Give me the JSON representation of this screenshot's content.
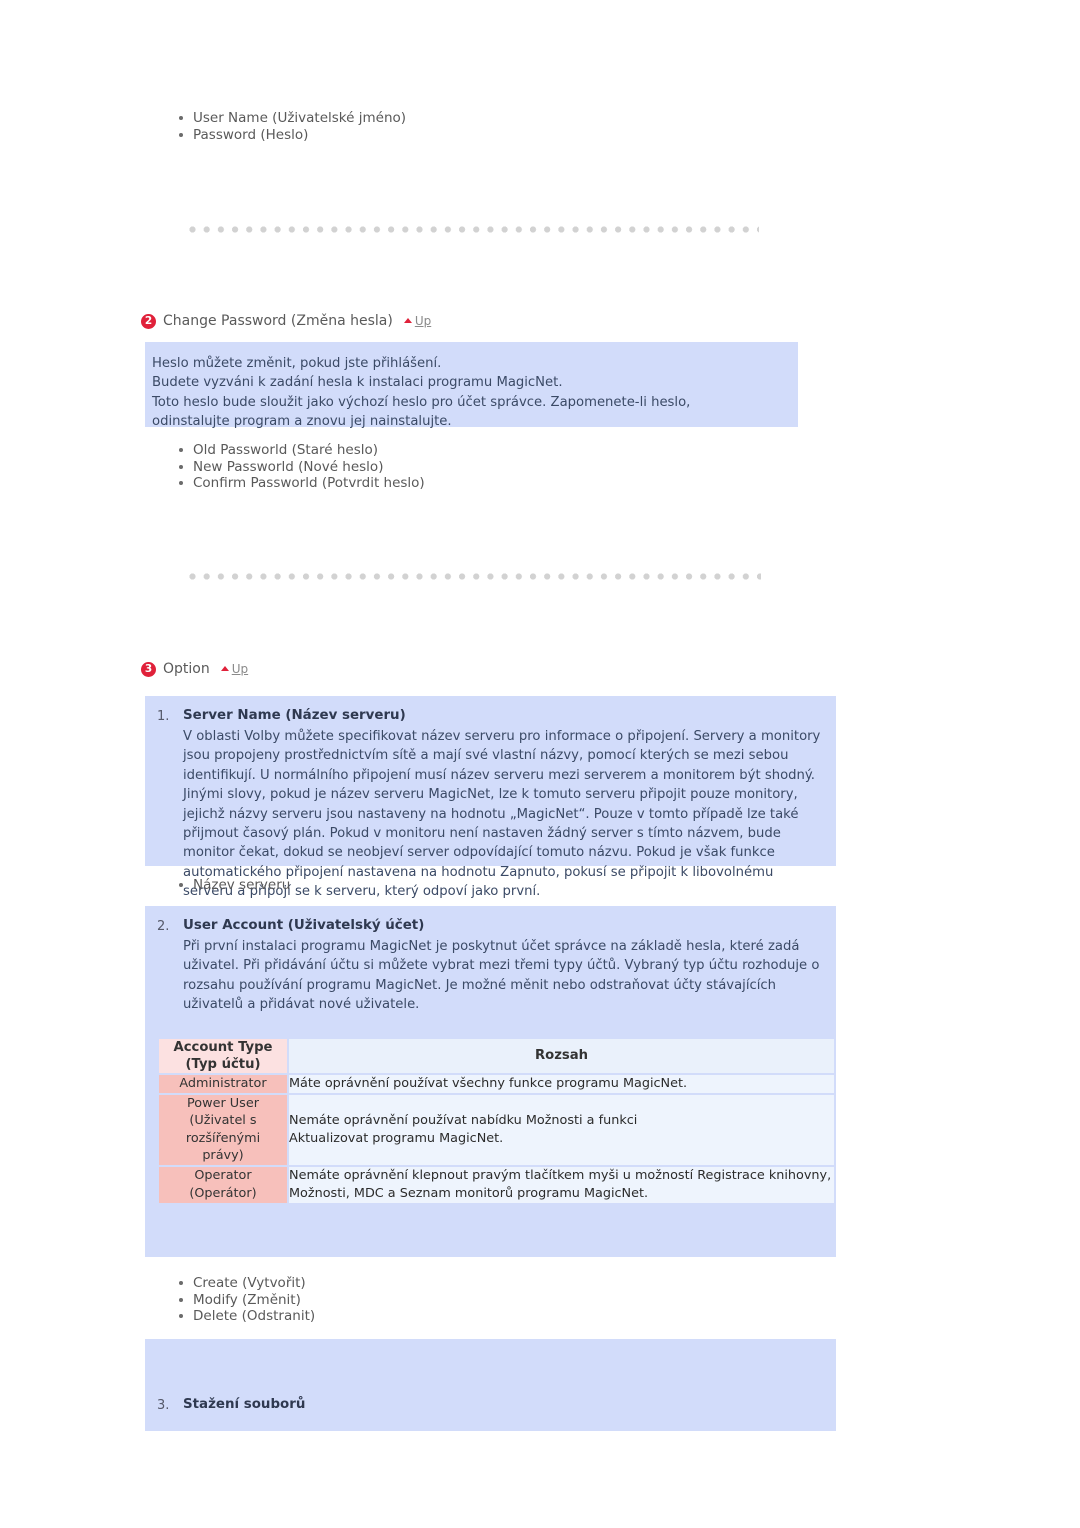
{
  "login_fields": {
    "items": [
      "User Name (Uživatelské jméno)",
      "Password (Heslo)"
    ]
  },
  "section_change_password": {
    "number": "2",
    "title": "Change Password (Změna hesla)",
    "up_label": "Up",
    "info_lines": [
      "Heslo můžete změnit, pokud jste přihlášení.",
      "Budete vyzváni k zadání hesla k instalaci programu MagicNet.",
      "Toto heslo bude sloužit jako výchozí heslo pro účet správce. Zapomenete-li heslo, odinstalujte program a znovu jej nainstalujte."
    ],
    "items": [
      "Old Passworld (Staré heslo)",
      "New Passworld (Nové heslo)",
      "Confirm Passworld (Potvrdit heslo)"
    ]
  },
  "section_option": {
    "number": "3",
    "title": "Option",
    "up_label": "Up",
    "server_name": {
      "index": "1.",
      "heading": "Server Name (Název serveru)",
      "paragraph": "V oblasti Volby můžete specifikovat název serveru pro informace o připojení. Servery a monitory jsou propojeny prostřednictvím sítě a mají své vlastní názvy, pomocí kterých se mezi sebou identifikují. U normálního připojení musí název serveru mezi serverem a monitorem být shodný. Jinými slovy, pokud je název serveru MagicNet, lze k tomuto serveru připojit pouze monitory, jejichž názvy serveru jsou nastaveny na hodnotu „MagicNet“. Pouze v tomto případě lze také přijmout časový plán. Pokud v monitoru není nastaven žádný server s tímto názvem, bude monitor čekat, dokud se neobjeví server odpovídající tomuto názvu. Pokud je však funkce automatického připojení nastavena na hodnotu Zapnuto, pokusí se připojit k libovolnému serveru a připojí se k serveru, který odpoví jako první."
    },
    "server_name_bullets": [
      "Název serveru"
    ],
    "user_account": {
      "index": "2.",
      "heading": "User Account (Uživatelský účet)",
      "paragraph": "Při první instalaci programu MagicNet je poskytnut účet správce na základě hesla, které zadá uživatel. Při přidávání účtu si můžete vybrat mezi třemi typy účtů. Vybraný typ účtu rozhoduje o rozsahu používání programu MagicNet. Je možné měnit nebo odstraňovat účty stávajících uživatelů a přidávat nové uživatele."
    },
    "account_table": {
      "headers": [
        "Account Type\n(Typ účtu)",
        "Rozsah"
      ],
      "header_type_line1": "Account Type",
      "header_type_line2": "(Typ účtu)",
      "header_scope": "Rozsah",
      "rows": [
        {
          "type": "Administrator",
          "type_lines": [
            "Administrator"
          ],
          "scope": "Máte oprávnění používat všechny funkce programu MagicNet."
        },
        {
          "type": "Power User (Uživatel s rozšířenými právy)",
          "type_lines": [
            "Power User",
            "(Uživatel s",
            "rozšířenými",
            "právy)"
          ],
          "scope": "Nemáte oprávnění používat nabídku Možnosti a funkci Aktualizovat programu MagicNet."
        },
        {
          "type": "Operator (Operátor)",
          "type_lines": [
            "Operator",
            "(Operátor)"
          ],
          "scope": "Nemáte oprávnění klepnout pravým tlačítkem myši u možností Registrace knihovny, Možnosti, MDC a Seznam monitorů programu MagicNet."
        }
      ]
    },
    "user_account_bullets": [
      "Create (Vytvořit)",
      "Modify (Změnit)",
      "Delete (Odstranit)"
    ],
    "file_download": {
      "index": "3.",
      "heading": "Stažení souborů"
    }
  },
  "colors": {
    "panel_bg": "#d2dcfa",
    "accent_red": "#e0213a",
    "table_header_pink": "#fce1e1",
    "table_cell_pink": "#f7c0bb",
    "table_cell_blue": "#eef4fd",
    "dot_gray": "#d2d2d2"
  }
}
